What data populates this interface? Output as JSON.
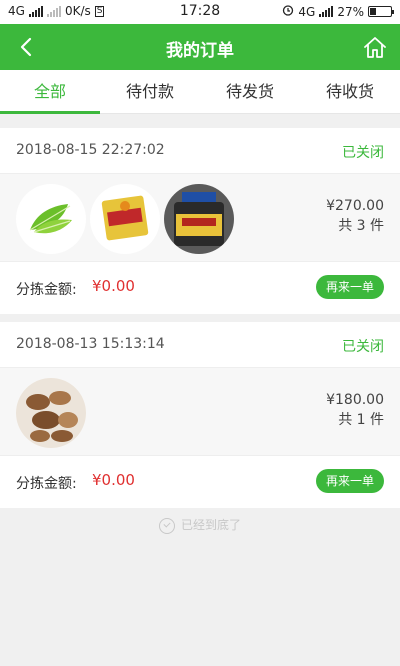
{
  "statusbar": {
    "network_left": "4G",
    "speed": "0K/s",
    "s_badge": "S",
    "time": "17:28",
    "network_right": "4G",
    "battery": "27%",
    "battery_level": 0.27
  },
  "header": {
    "title": "我的订单",
    "back_icon": "chevron-left-icon",
    "home_icon": "home-icon"
  },
  "tabs": [
    {
      "label": "全部",
      "active": true
    },
    {
      "label": "待付款",
      "active": false
    },
    {
      "label": "待发货",
      "active": false
    },
    {
      "label": "待收货",
      "active": false
    }
  ],
  "orders": [
    {
      "date": "2018-08-15 22:27:02",
      "status": "已关闭",
      "products": [
        "lettuce",
        "pickled-mustard-pack",
        "sauce-jar"
      ],
      "amount": "¥270.00",
      "count": "共 3 件",
      "sort_label": "分拣金额:",
      "sort_amount": "¥0.00",
      "reorder": "再来一单"
    },
    {
      "date": "2018-08-13 15:13:14",
      "status": "已关闭",
      "products": [
        "brown-mushrooms"
      ],
      "amount": "¥180.00",
      "count": "共 1 件",
      "sort_label": "分拣金额:",
      "sort_amount": "¥0.00",
      "reorder": "再来一单"
    }
  ],
  "footer": {
    "end_text": "已经到底了"
  },
  "colors": {
    "brand_green": "#3cb83c",
    "price_red": "#e03030"
  }
}
